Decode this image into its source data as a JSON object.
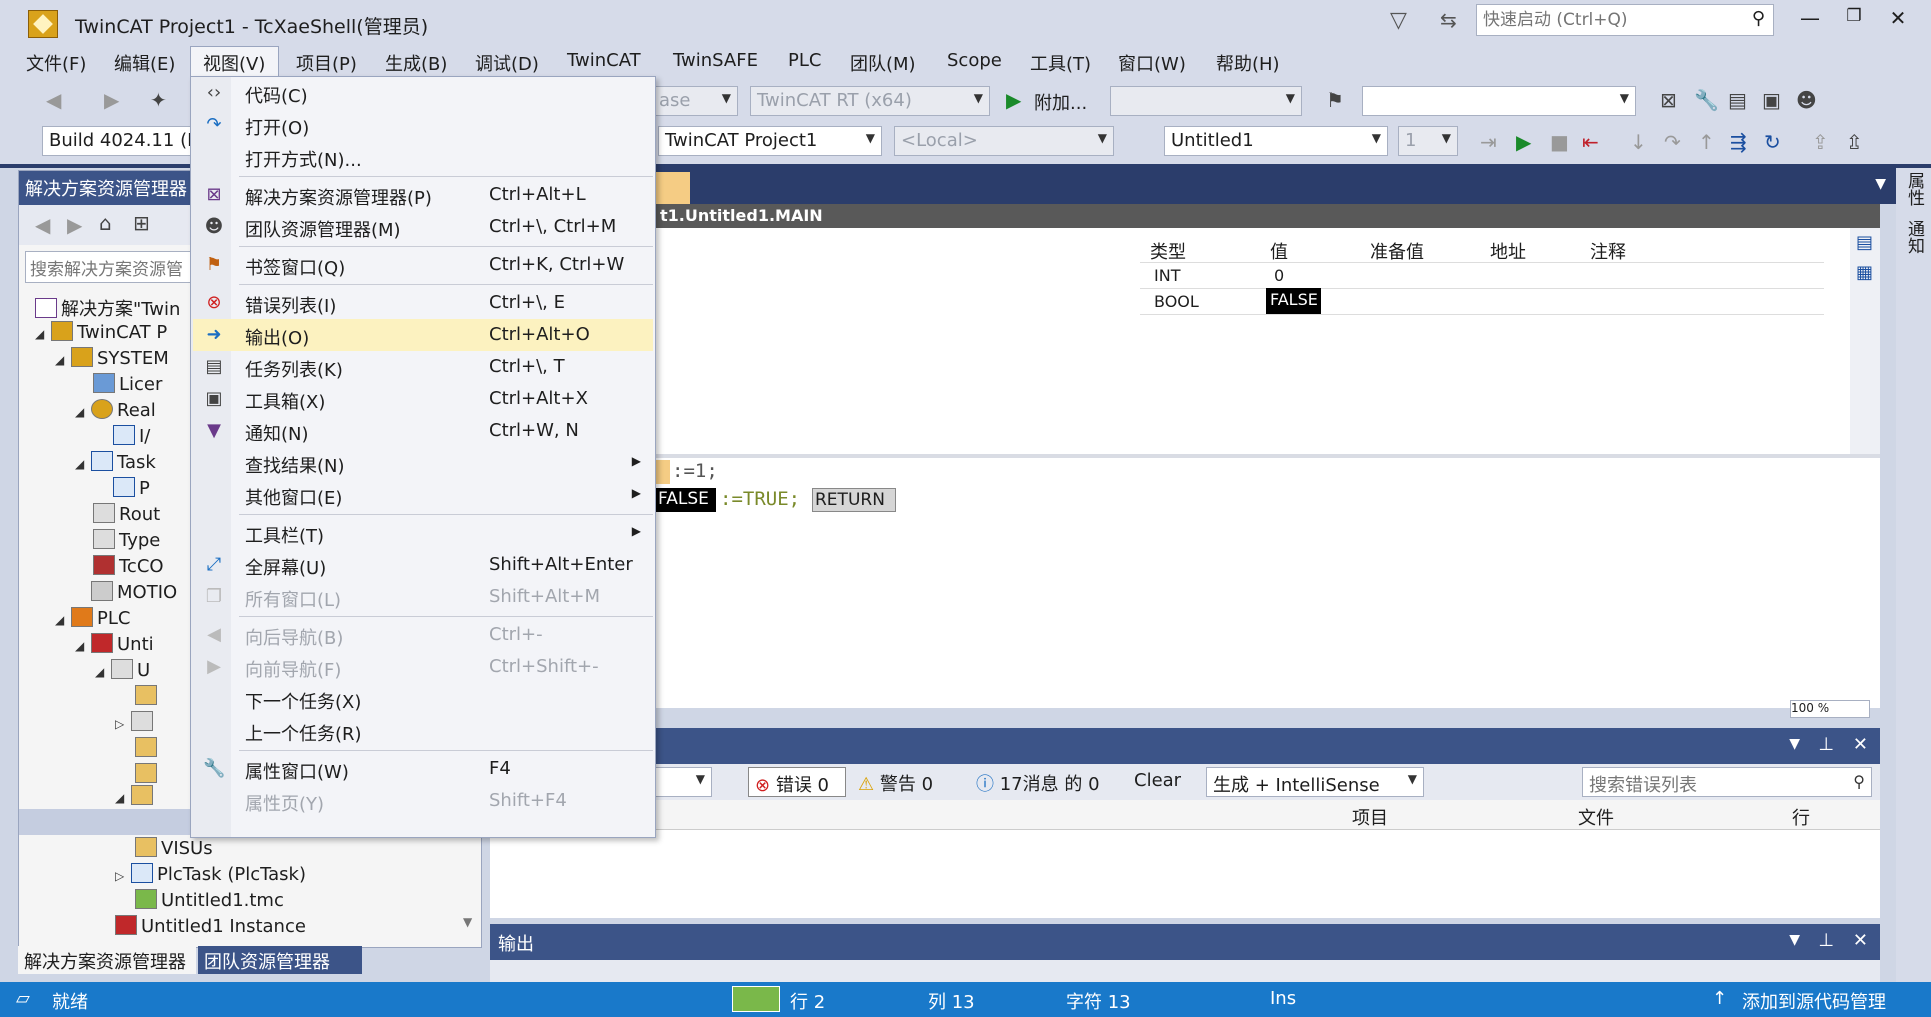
{
  "window": {
    "title": "TwinCAT Project1 - TcXaeShell(管理员)",
    "quick_launch_placeholder": "快速启动 (Ctrl+Q)"
  },
  "menubar": [
    "文件(F)",
    "编辑(E)",
    "视图(V)",
    "项目(P)",
    "生成(B)",
    "调试(D)",
    "TwinCAT",
    "TwinSAFE",
    "PLC",
    "团队(M)",
    "Scope",
    "工具(T)",
    "窗口(W)",
    "帮助(H)"
  ],
  "toolbar1": {
    "config_combo": "ase",
    "platform_combo": "TwinCAT RT (x64)",
    "attach_label": "附加..."
  },
  "toolbar2": {
    "build_combo": "Build 4024.11 (L",
    "project_combo": "TwinCAT Project1",
    "target_combo": "<Local>",
    "plc_combo": "Untitled1",
    "index_combo": "1"
  },
  "solution_explorer": {
    "title": "解决方案资源管理器",
    "search_placeholder": "搜索解决方案资源管",
    "tree": [
      "解决方案\"Twin",
      "TwinCAT P",
      "SYSTEM",
      "Licer",
      "Real",
      "I/",
      "Task",
      "P",
      "Rout",
      "Type",
      "TcCO",
      "MOTIO",
      "PLC",
      "Unti",
      "U",
      "VISUs",
      "PlcTask (PlcTask)",
      "Untitled1.tmc",
      "Untitled1 Instance"
    ],
    "bottom_tabs": [
      "解决方案资源管理器",
      "团队资源管理器"
    ]
  },
  "editor": {
    "path": "t1.Untitled1.MAIN",
    "columns": [
      "类型",
      "值",
      "准备值",
      "地址",
      "注释"
    ],
    "rows": [
      {
        "type": "INT",
        "value": "0"
      },
      {
        "type": "BOOL",
        "value": "FALSE"
      }
    ],
    "code_line1_op": ":=1;",
    "code_line2_value": "FALSE",
    "code_line2_op": ":=TRUE;",
    "code_line2_return": "RETURN",
    "zoom": "100 %"
  },
  "error_list": {
    "errors": "错误 0",
    "warnings": "警告 0",
    "messages": "17消息 的 0",
    "clear": "Clear",
    "filter": "生成 + IntelliSense",
    "search_placeholder": "搜索错误列表",
    "columns": [
      "项目",
      "文件",
      "行"
    ]
  },
  "output": {
    "title": "输出"
  },
  "right_strip": [
    "属性",
    "通知"
  ],
  "view_menu": {
    "items": [
      {
        "label": "代码(C)",
        "shortcut": "",
        "icon": "code-icon"
      },
      {
        "label": "打开(O)",
        "shortcut": "",
        "icon": "open-arrow-icon"
      },
      {
        "label": "打开方式(N)...",
        "shortcut": "",
        "icon": ""
      },
      {
        "label": "解决方案资源管理器(P)",
        "shortcut": "Ctrl+Alt+L",
        "icon": "solution-explorer-icon"
      },
      {
        "label": "团队资源管理器(M)",
        "shortcut": "Ctrl+\\, Ctrl+M",
        "icon": "team-icon"
      },
      {
        "label": "书签窗口(Q)",
        "shortcut": "Ctrl+K, Ctrl+W",
        "icon": "bookmark-icon"
      },
      {
        "label": "错误列表(I)",
        "shortcut": "Ctrl+\\, E",
        "icon": "error-list-icon"
      },
      {
        "label": "输出(O)",
        "shortcut": "Ctrl+Alt+O",
        "icon": "output-icon"
      },
      {
        "label": "任务列表(K)",
        "shortcut": "Ctrl+\\, T",
        "icon": "task-list-icon"
      },
      {
        "label": "工具箱(X)",
        "shortcut": "Ctrl+Alt+X",
        "icon": "toolbox-icon"
      },
      {
        "label": "通知(N)",
        "shortcut": "Ctrl+W, N",
        "icon": "notification-flag-icon"
      },
      {
        "label": "查找结果(N)",
        "shortcut": "",
        "icon": ""
      },
      {
        "label": "其他窗口(E)",
        "shortcut": "",
        "icon": ""
      },
      {
        "label": "工具栏(T)",
        "shortcut": "",
        "icon": ""
      },
      {
        "label": "全屏幕(U)",
        "shortcut": "Shift+Alt+Enter",
        "icon": "fullscreen-icon"
      },
      {
        "label": "所有窗口(L)",
        "shortcut": "Shift+Alt+M",
        "icon": "all-windows-icon"
      },
      {
        "label": "向后导航(B)",
        "shortcut": "Ctrl+-",
        "icon": "nav-back-icon"
      },
      {
        "label": "向前导航(F)",
        "shortcut": "Ctrl+Shift+-",
        "icon": "nav-forward-icon"
      },
      {
        "label": "下一个任务(X)",
        "shortcut": "",
        "icon": ""
      },
      {
        "label": "上一个任务(R)",
        "shortcut": "",
        "icon": ""
      },
      {
        "label": "属性窗口(W)",
        "shortcut": "F4",
        "icon": "wrench-icon"
      },
      {
        "label": "属性页(Y)",
        "shortcut": "Shift+F4",
        "icon": ""
      }
    ]
  },
  "statusbar": {
    "ready": "就绪",
    "line": "行 2",
    "col": "列 13",
    "char": "字符 13",
    "mode": "Ins",
    "source_control": "添加到源代码管理"
  }
}
